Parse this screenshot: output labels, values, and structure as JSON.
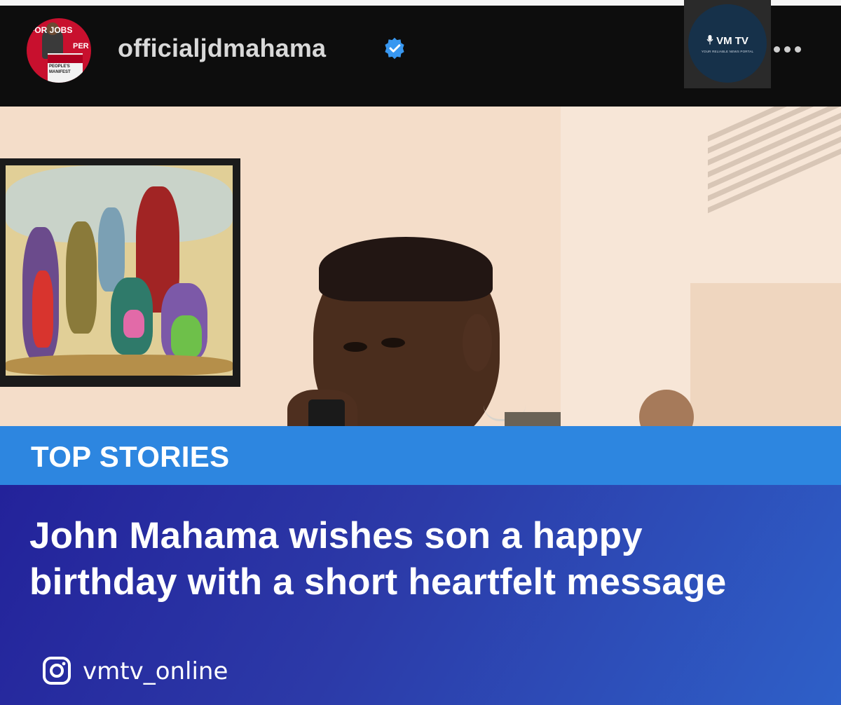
{
  "post_header": {
    "username": "officialjdmahama",
    "avatar_text": [
      "FOR JOBS",
      "PER",
      "PEOPLE'S",
      "MANIFEST"
    ],
    "verified_icon": "verified-badge-icon",
    "more_icon": "more-horizontal-icon"
  },
  "brand_logo": {
    "title": "VM TV",
    "tagline": "YOUR RELIABLE NEWS PORTAL",
    "icon": "microphone-icon"
  },
  "banner": {
    "label": "TOP STORIES"
  },
  "headline": {
    "text": "John Mahama wishes son a happy birthday with a short heartfelt message"
  },
  "footer": {
    "social_icon": "instagram-icon",
    "handle": "vmtv_online"
  },
  "colors": {
    "banner": "#2d86e0",
    "panel_start": "#23229a",
    "panel_end": "#2e60c8",
    "header_bg": "#0d0d0d",
    "verified": "#3897f0"
  }
}
